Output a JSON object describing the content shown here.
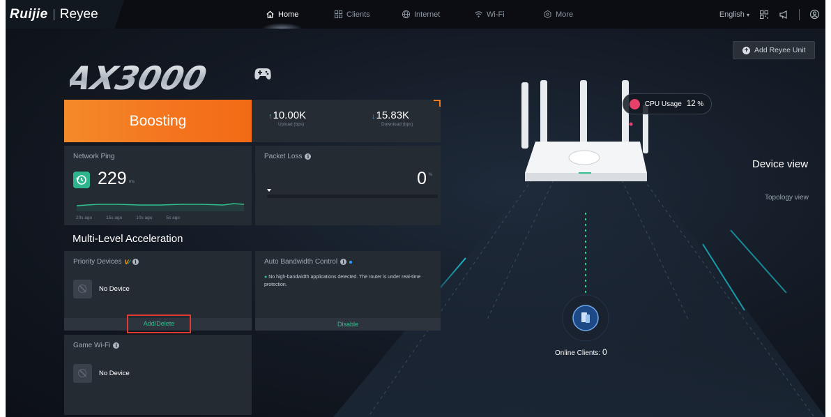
{
  "brand": {
    "logo_main": "Ruijie",
    "logo_sub": "Reyee"
  },
  "nav": {
    "items": [
      {
        "label": "Home",
        "icon": "home-icon",
        "active": true
      },
      {
        "label": "Clients",
        "icon": "clients-icon",
        "active": false
      },
      {
        "label": "Internet",
        "icon": "globe-icon",
        "active": false
      },
      {
        "label": "Wi-Fi",
        "icon": "wifi-icon",
        "active": false
      },
      {
        "label": "More",
        "icon": "settings-icon",
        "active": false
      }
    ]
  },
  "topright": {
    "language": "English",
    "language_caret": "▾"
  },
  "add_unit": {
    "label": "Add Reyee Unit"
  },
  "model": {
    "name": "AX3000"
  },
  "boost": {
    "label": "Boosting"
  },
  "traffic": {
    "upload_value": "10.00K",
    "upload_label": "Upload (bps)",
    "download_value": "15.83K",
    "download_label": "Download (bps)"
  },
  "ping": {
    "title": "Network Ping",
    "value": "229",
    "unit": "ms",
    "axis": [
      "20s ago",
      "15s ago",
      "10s ago",
      "5s ago"
    ]
  },
  "loss": {
    "title": "Packet Loss",
    "value": "0",
    "unit": "%"
  },
  "section": {
    "title": "Multi-Level Acceleration"
  },
  "priority": {
    "title": "Priority Devices",
    "badge": "V",
    "empty": "No Device",
    "action": "Add/Delete"
  },
  "abc": {
    "title": "Auto Bandwidth Control",
    "message": "No high-bandwidth applications detected. The router is under real-time protection.",
    "action": "Disable"
  },
  "gamewifi": {
    "title": "Game Wi-Fi",
    "empty": "No Device"
  },
  "device": {
    "device_view": "Device view",
    "topology_view": "Topology view",
    "cpu_label": "CPU Usage",
    "cpu_value": "12",
    "cpu_unit": "%",
    "online_label": "Online Clients:",
    "online_value": "0"
  },
  "colors": {
    "accent_orange": "#f4751f",
    "accent_green": "#2fc28e",
    "highlight_red": "#e03a30",
    "cpu_pink": "#e6406b"
  }
}
